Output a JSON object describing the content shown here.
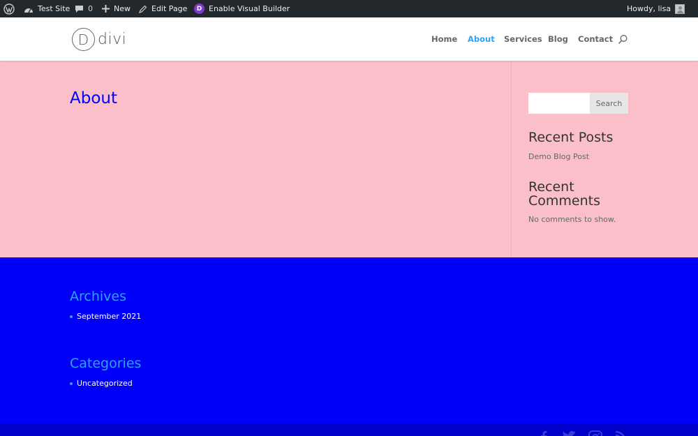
{
  "admin_bar": {
    "site_name": "Test Site",
    "comments_count": "0",
    "new_label": "New",
    "edit_label": "Edit Page",
    "builder_label": "Enable Visual Builder",
    "builder_badge": "D",
    "greeting": "Howdy, lisa"
  },
  "header": {
    "logo_letter": "D",
    "logo_text": "divi",
    "nav": [
      "Home",
      "About",
      "Services",
      "Blog",
      "Contact"
    ],
    "active_nav": "About"
  },
  "main": {
    "page_title": "About",
    "sidebar": {
      "search_button": "Search",
      "search_placeholder": "",
      "recent_posts_title": "Recent Posts",
      "recent_posts": [
        "Demo Blog Post"
      ],
      "recent_comments_title_line1": "Recent",
      "recent_comments_title_line2": "Comments",
      "no_comments": "No comments to show."
    }
  },
  "footer": {
    "archives_title": "Archives",
    "archives": [
      "September 2021"
    ],
    "categories_title": "Categories",
    "categories": [
      "Uncategorized"
    ]
  },
  "social": [
    "facebook-icon",
    "twitter-icon",
    "instagram-icon",
    "rss-icon"
  ],
  "colors": {
    "admin_bar_bg": "#23282d",
    "accent": "#2ea3f2",
    "main_bg": "#fbbfca",
    "page_title": "#0000ff",
    "footer_bg": "#0000f8",
    "builder_badge": "#7e3bd0"
  }
}
